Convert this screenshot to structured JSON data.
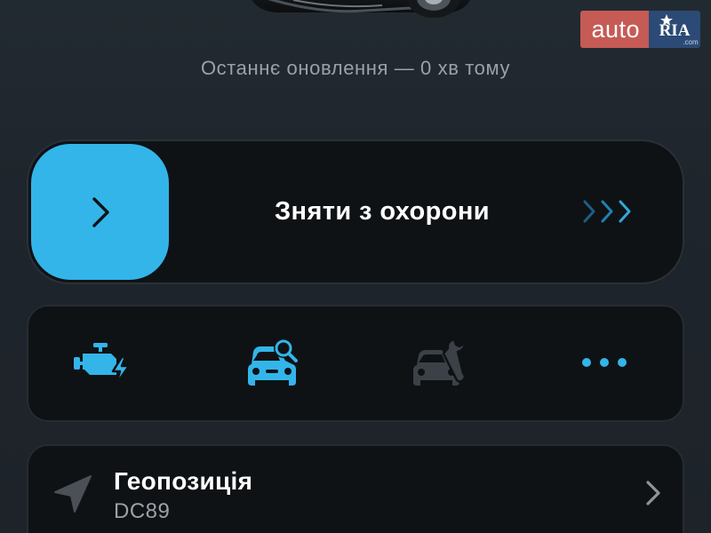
{
  "header": {
    "car_image": "car-silhouette",
    "last_update": "Останнє оновлення — 0 хв тому"
  },
  "watermark": {
    "auto": "auto",
    "ria": "RIA",
    "ria_sub": ".com"
  },
  "slider": {
    "label": "Зняти з охорони",
    "knob_icon": "chevron-right-icon",
    "hint_icon": "triple-chevron-right-icon",
    "accent_color": "#33b5ea"
  },
  "quick_actions": [
    {
      "icon": "engine-start-icon",
      "state": "active"
    },
    {
      "icon": "car-search-icon",
      "state": "active"
    },
    {
      "icon": "car-service-icon",
      "state": "disabled"
    },
    {
      "icon": "more-icon",
      "state": "active"
    }
  ],
  "geo": {
    "title": "Геопозиція",
    "subtitle": "DC89",
    "icon": "location-arrow-icon"
  },
  "colors": {
    "background": "#1f252c",
    "card": "#0f1215",
    "accent": "#33b5ea",
    "muted": "#9aa2a8",
    "disabled_icon": "#3b4147"
  }
}
